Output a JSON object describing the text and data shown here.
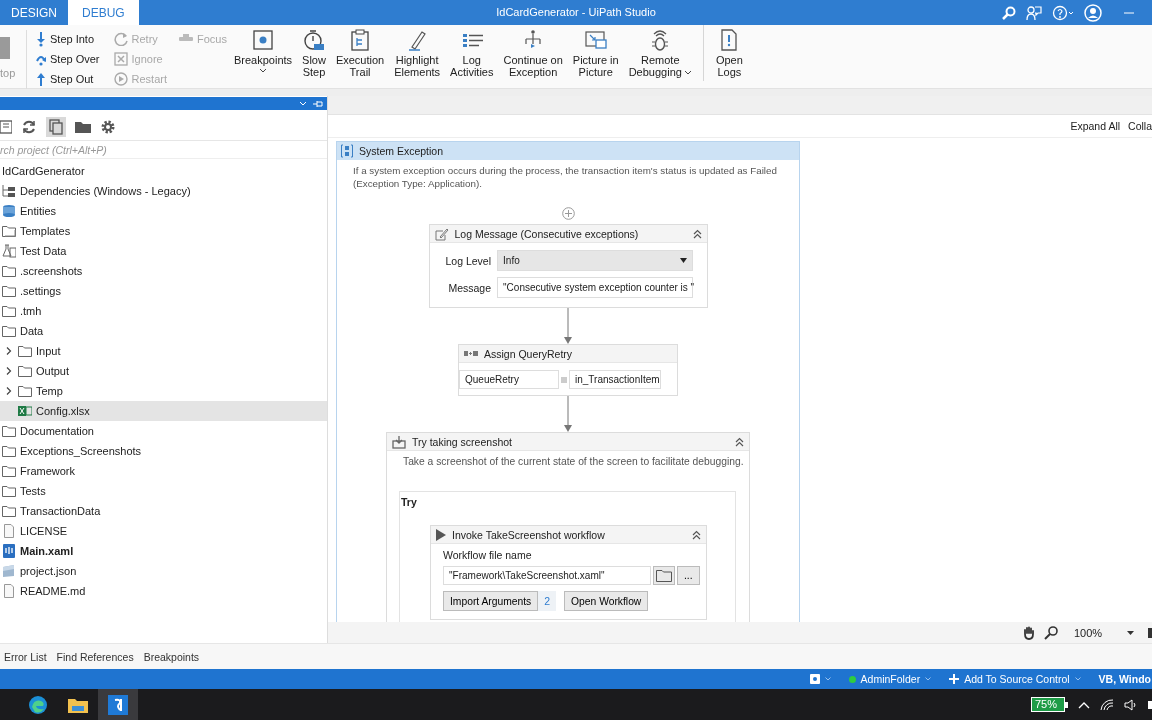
{
  "title_bar": {
    "tabs": [
      {
        "label": "DESIGN",
        "selected": false
      },
      {
        "label": "DEBUG",
        "selected": true
      }
    ],
    "title": "IdCardGenerator - UiPath Studio"
  },
  "ribbon": {
    "partial_label": "top",
    "step_buttons": [
      {
        "label": "Step Into",
        "disabled": false
      },
      {
        "label": "Step Over",
        "disabled": false
      },
      {
        "label": "Step Out",
        "disabled": false
      }
    ],
    "recovery_buttons": [
      {
        "label": "Retry",
        "disabled": true
      },
      {
        "label": "Ignore",
        "disabled": true
      },
      {
        "label": "Restart",
        "disabled": true
      }
    ],
    "focus_button": {
      "label": "Focus",
      "disabled": true
    },
    "large_buttons": [
      {
        "label": "Breakpoints",
        "dropdown": true,
        "separator": false
      },
      {
        "label": "Slow\nStep",
        "dropdown": false,
        "separator": false
      },
      {
        "label": "Execution\nTrail",
        "dropdown": false,
        "separator": false
      },
      {
        "label": "Highlight\nElements",
        "dropdown": false,
        "separator": false
      },
      {
        "label": "Log\nActivities",
        "dropdown": false,
        "separator": false
      },
      {
        "label": "Continue on\nException",
        "dropdown": false,
        "separator": false
      },
      {
        "label": "Picture in\nPicture",
        "dropdown": false,
        "separator": false
      },
      {
        "label": "Remote\nDebugging",
        "dropdown": true,
        "separator": false
      },
      {
        "label": "Open\nLogs",
        "dropdown": false,
        "separator": true
      }
    ]
  },
  "project_panel": {
    "search": {
      "placeholder": "rch project (Ctrl+Alt+P)"
    },
    "tree": [
      {
        "label": "IdCardGenerator",
        "selected": false,
        "children": [
          {
            "label": "Dependencies (Windows - Legacy)",
            "kind": "dependencies",
            "selected": false
          },
          {
            "label": "Entities",
            "kind": "entities",
            "selected": false
          },
          {
            "label": "Templates",
            "kind": "templates",
            "selected": false
          },
          {
            "label": "Test Data",
            "kind": "testdata",
            "selected": false
          },
          {
            "label": ".screenshots",
            "kind": "folder",
            "selected": false
          },
          {
            "label": ".settings",
            "kind": "folder",
            "selected": false
          },
          {
            "label": ".tmh",
            "kind": "folder",
            "selected": false
          },
          {
            "label": "Data",
            "kind": "folder",
            "selected": false,
            "children": [
              {
                "label": "Input",
                "kind": "folder",
                "selected": false,
                "expanded": false
              },
              {
                "label": "Output",
                "kind": "folder",
                "selected": false,
                "expanded": false
              },
              {
                "label": "Temp",
                "kind": "folder",
                "selected": false,
                "expanded": false
              },
              {
                "label": "Config.xlsx",
                "kind": "excel",
                "selected": true
              }
            ]
          },
          {
            "label": "Documentation",
            "kind": "folder",
            "selected": false
          },
          {
            "label": "Exceptions_Screenshots",
            "kind": "folder",
            "selected": false
          },
          {
            "label": "Framework",
            "kind": "folder",
            "selected": false
          },
          {
            "label": "Tests",
            "kind": "folder",
            "selected": false
          },
          {
            "label": "TransactionData",
            "kind": "folder",
            "selected": false
          },
          {
            "label": "LICENSE",
            "kind": "file",
            "selected": false
          },
          {
            "label": "Main.xaml",
            "kind": "xaml",
            "selected": false
          },
          {
            "label": "project.json",
            "kind": "json",
            "selected": false
          },
          {
            "label": "README.md",
            "kind": "file",
            "selected": false
          }
        ]
      }
    ]
  },
  "canvas": {
    "toolbar": [
      "Expand All",
      "Colla"
    ],
    "sequence": {
      "title": "System Exception",
      "description": "If a system exception occurs during the process, the transaction item's status is updated as Failed (Exception Type: Application).",
      "activities": [
        {
          "kind": "log",
          "title": "Log Message (Consecutive exceptions)",
          "level_label": "Log Level",
          "level_value": "Info",
          "message_label": "Message",
          "message_value": "\"Consecutive system exception counter is \""
        },
        {
          "kind": "assign",
          "title": "Assign QueryRetry",
          "to": "QueueRetry",
          "value": "in_TransactionItem"
        },
        {
          "kind": "try",
          "title": "Try taking screenshot",
          "description": "Take a screenshot of the current state of the screen to facilitate debugging.",
          "try_label": "Try",
          "inner": {
            "title": "Invoke TakeScreenshot workflow",
            "file_label": "Workflow file name",
            "file_value": "\"Framework\\TakeScreenshot.xaml\"",
            "browse": "...",
            "import_button": "Import Arguments",
            "argument_count": "2",
            "open_button": "Open Workflow"
          }
        }
      ]
    },
    "zoom": "100%"
  },
  "panel_tabs": [
    "Error List",
    "Find References",
    "Breakpoints"
  ],
  "status_bar": {
    "folder": {
      "label": "AdminFolder",
      "color": "#2ecc40"
    },
    "source_control": "Add To Source Control",
    "language": "VB, Windo"
  },
  "taskbar": {
    "battery": "75%"
  }
}
